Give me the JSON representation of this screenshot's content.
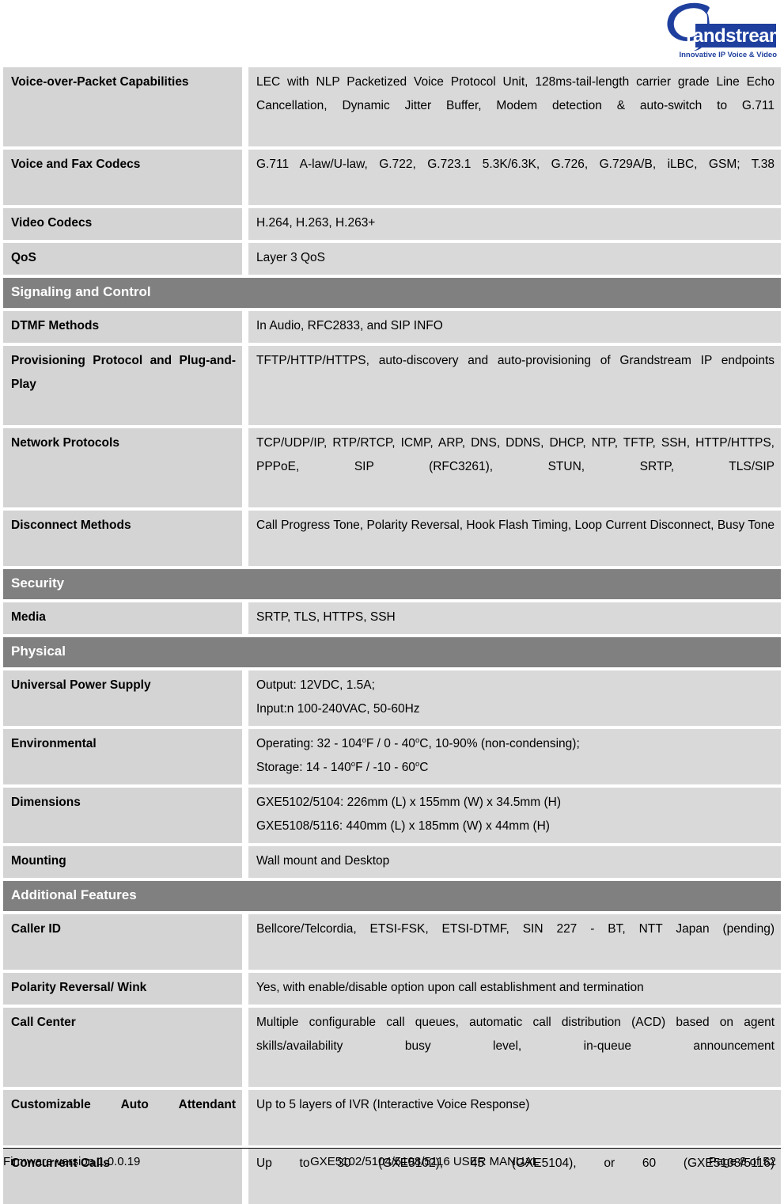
{
  "document": {
    "logo": {
      "brand": "Grandstream",
      "tagline": "Innovative IP Voice & Video",
      "color": "#1F3F9E"
    }
  },
  "table": {
    "rows": [
      {
        "kind": "spec",
        "label": "Voice-over-Packet Capabilities",
        "value": "LEC with NLP Packetized Voice Protocol Unit, 128ms-tail-length carrier grade Line Echo Cancellation, Dynamic Jitter Buffer, Modem detection & auto-switch to G.711",
        "label_justify": false,
        "value_justify": true
      },
      {
        "kind": "spec",
        "label": "Voice and Fax Codecs",
        "value": "G.711 A-law/U-law, G.722, G.723.1 5.3K/6.3K, G.726, G.729A/B, iLBC, GSM; T.38",
        "label_justify": false,
        "value_justify": true
      },
      {
        "kind": "spec",
        "label": "Video Codecs",
        "value": "H.264, H.263, H.263+",
        "label_justify": false,
        "value_justify": false
      },
      {
        "kind": "spec",
        "label": "QoS",
        "value": "Layer 3 QoS",
        "label_justify": false,
        "value_justify": false
      },
      {
        "kind": "section",
        "label": "Signaling and Control"
      },
      {
        "kind": "spec",
        "label": "DTMF Methods",
        "value": "In Audio, RFC2833, and SIP INFO",
        "label_justify": false,
        "value_justify": false
      },
      {
        "kind": "spec",
        "label": "Provisioning Protocol and Plug-and-Play",
        "value": "TFTP/HTTP/HTTPS, auto-discovery and auto-provisioning of Grandstream IP endpoints",
        "label_justify": true,
        "value_justify": true
      },
      {
        "kind": "spec",
        "label": "Network Protocols",
        "value": "TCP/UDP/IP, RTP/RTCP, ICMP, ARP, DNS, DDNS, DHCP, NTP, TFTP, SSH, HTTP/HTTPS, PPPoE, SIP (RFC3261), STUN, SRTP, TLS/SIP",
        "label_justify": false,
        "value_justify": true
      },
      {
        "kind": "spec",
        "label": "Disconnect Methods",
        "value": "Call Progress Tone, Polarity Reversal, Hook Flash Timing, Loop Current Disconnect, Busy Tone",
        "label_justify": false,
        "value_justify": true
      },
      {
        "kind": "section",
        "label": "Security"
      },
      {
        "kind": "spec",
        "label": "Media",
        "value": "SRTP, TLS, HTTPS, SSH",
        "label_justify": false,
        "value_justify": false
      },
      {
        "kind": "section",
        "label": "Physical"
      },
      {
        "kind": "spec-lines",
        "label": "Universal Power Supply",
        "value_lines": [
          "Output: 12VDC, 1.5A;",
          "Input:n 100-240VAC, 50-60Hz"
        ],
        "label_justify": false
      },
      {
        "kind": "spec-lines",
        "label": "Environmental",
        "value_lines": [
          "Operating: 32 - 104°F / 0 - 40°C, 10-90% (non-condensing);",
          "Storage: 14 - 140°F / -10 - 60°C"
        ],
        "label_justify": false
      },
      {
        "kind": "spec-lines",
        "label": "Dimensions",
        "value_lines": [
          "GXE5102/5104: 226mm (L) x 155mm (W) x 34.5mm (H)",
          "GXE5108/5116: 440mm (L) x 185mm (W) x 44mm (H)"
        ],
        "label_justify": false
      },
      {
        "kind": "spec",
        "label": "Mounting",
        "value": "Wall mount and Desktop",
        "label_justify": false,
        "value_justify": false
      },
      {
        "kind": "section",
        "label": "Additional Features"
      },
      {
        "kind": "spec",
        "label": "Caller ID",
        "value": "Bellcore/Telcordia, ETSI-FSK, ETSI-DTMF, SIN 227 - BT, NTT Japan (pending)",
        "label_justify": false,
        "value_justify": true
      },
      {
        "kind": "spec",
        "label": "Polarity Reversal/ Wink",
        "value": "Yes, with enable/disable option upon call establishment and termination",
        "label_justify": false,
        "value_justify": false
      },
      {
        "kind": "spec",
        "label": "Call Center",
        "value": "Multiple configurable call queues, automatic call distribution (ACD) based on agent skills/availability busy level, in-queue announcement",
        "label_justify": false,
        "value_justify": true
      },
      {
        "kind": "spec",
        "label": "Customizable Auto Attendant",
        "value": "Up to 5 layers of IVR (Interactive Voice Response)",
        "label_justify": true,
        "value_justify": false
      },
      {
        "kind": "spec",
        "label": "Concurrent Calls",
        "value": "Up to 30 (GXE5102), 45 (GXE5104), or 60 (GXE5108/5116)",
        "label_justify": false,
        "value_justify": true
      }
    ]
  },
  "footer": {
    "firmware": "Firmware version 1.0.0.19",
    "manual": "GXE5102/5104/5108/5116 USER MANUAL",
    "page": "Page 8 of 52"
  }
}
